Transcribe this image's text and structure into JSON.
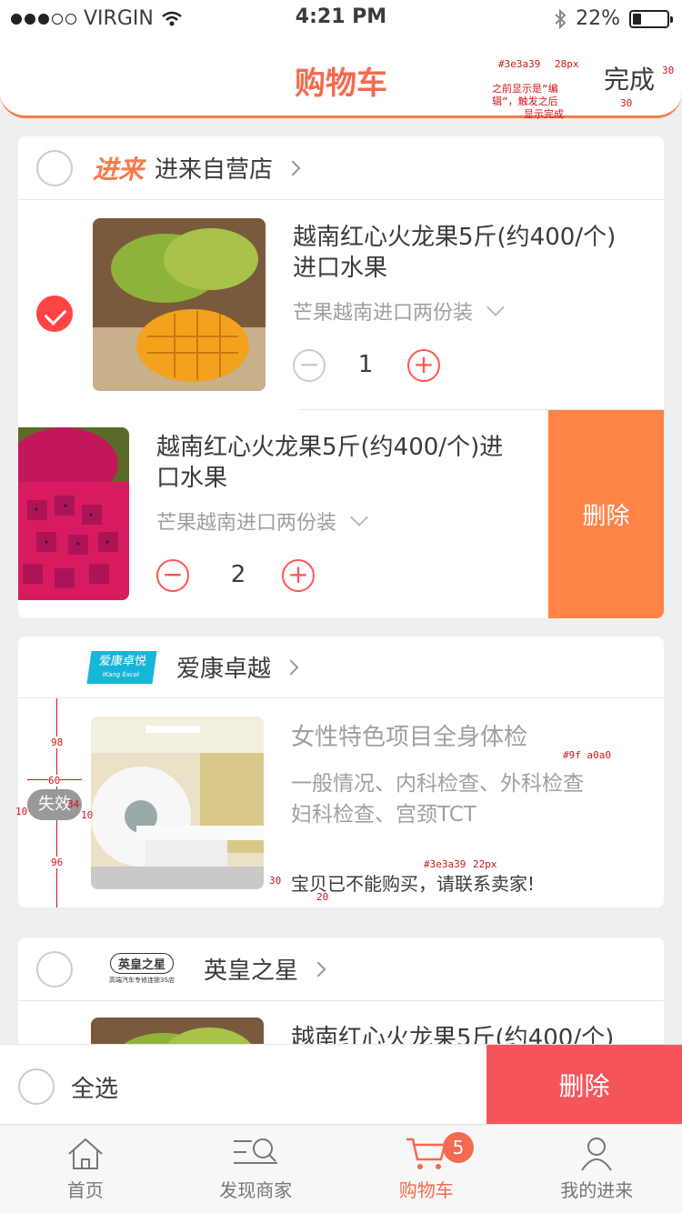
{
  "status": {
    "carrier": "VIRGIN",
    "time": "4:21 PM",
    "battery": "22%",
    "signal_dots_filled": 3,
    "signal_dots_total": 5
  },
  "header": {
    "title": "购物车",
    "action": "完成"
  },
  "annotations": {
    "color_a": "#3e3a39",
    "size_a": "28px",
    "right_gap": "30",
    "note_line1": "之前显示是“编",
    "note_line2": "辑”，触发之后",
    "note_line3": "显示完成",
    "bottom_gap": "30",
    "d98": "98",
    "d60": "60",
    "d34": "34",
    "d10a": "10",
    "d10b": "10",
    "d96": "96",
    "gray_color": "#9f a0a0",
    "invalid_color": "#3e3a39",
    "invalid_size": "22px",
    "d30": "30",
    "d20": "20"
  },
  "shops": [
    {
      "logo_text": "进来",
      "name": "进来自营店",
      "items": [
        {
          "title": "越南红心火龙果5斤(约400/个)进口水果",
          "spec": "芒果越南进口两份装",
          "qty": "1",
          "checked": true
        },
        {
          "title": "越南红心火龙果5斤(约400/个)进口水果",
          "spec": "芒果越南进口两份装",
          "qty": "2",
          "delete_label": "删除"
        }
      ]
    },
    {
      "logo_text": "爱康卓悦",
      "logo_sub": "iKang Excel",
      "name": "爱康卓越",
      "items": [
        {
          "title": "女性特色项目全身体检",
          "desc_line1": "一般情况、内科检查、外科检查",
          "desc_line2": "妇科检查、宫颈TCT",
          "notice": "宝贝已不能购买，请联系卖家!",
          "tag": "失效"
        }
      ]
    },
    {
      "logo_text": "英皇之星",
      "logo_sub": "高端汽车专修连锁3S店",
      "name": "英皇之星",
      "items": [
        {
          "title": "越南红心火龙果5斤(约400/个)"
        }
      ]
    }
  ],
  "footer": {
    "select_all": "全选",
    "delete": "删除"
  },
  "tabs": [
    {
      "label": "首页",
      "icon": "home-icon"
    },
    {
      "label": "发现商家",
      "icon": "discover-icon"
    },
    {
      "label": "购物车",
      "icon": "cart-icon",
      "badge": "5"
    },
    {
      "label": "我的进来",
      "icon": "user-icon"
    }
  ],
  "colors": {
    "accent": "#f46a4e",
    "delete_orange": "#fe8347",
    "delete_red": "#f5555a",
    "text": "#3e3a39",
    "gray": "#9f9f9f"
  }
}
